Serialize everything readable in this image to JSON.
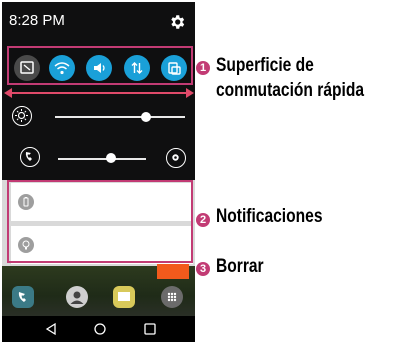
{
  "status_bar": {
    "time": "8:28 PM"
  },
  "quick_settings": {
    "toggles": [
      {
        "icon": "capture-icon",
        "active": false
      },
      {
        "icon": "wifi-icon",
        "active": true
      },
      {
        "icon": "volume-icon",
        "active": true
      },
      {
        "icon": "data-transfer-icon",
        "active": true
      },
      {
        "icon": "screen-rotation-icon",
        "active": true
      }
    ],
    "brightness_level": 0.7,
    "volume_level": 0.6
  },
  "notifications": [
    {
      "icon": "battery-icon"
    },
    {
      "icon": "bulb-icon"
    }
  ],
  "callouts": [
    {
      "number": "1",
      "line1": "Superficie de",
      "line2": "conmutación rápida"
    },
    {
      "number": "2",
      "line1": "Notificaciones"
    },
    {
      "number": "3",
      "line1": "Borrar"
    }
  ],
  "colors": {
    "accent": "#c23b74",
    "toggle_active": "#1aa0d8",
    "clear": "#f25a1c"
  }
}
